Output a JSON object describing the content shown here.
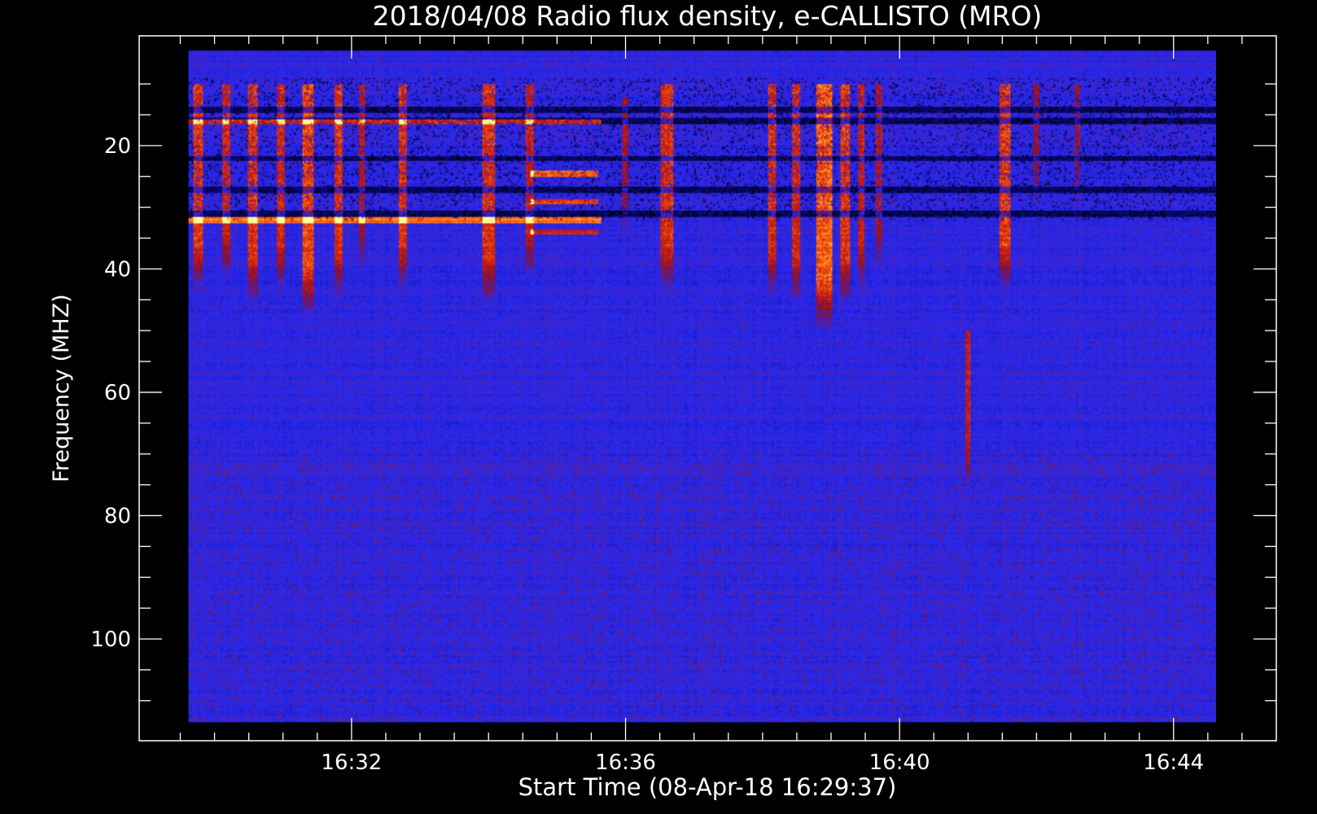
{
  "chart_data": {
    "type": "heatmap",
    "title": "2018/04/08  Radio flux density, e-CALLISTO (MRO)",
    "xlabel": "Start Time (08-Apr-18 16:29:37)",
    "ylabel": "Frequency (MHZ)",
    "x_ticks": [
      "16:32",
      "16:36",
      "16:40",
      "16:44"
    ],
    "x_tick_minutes": [
      32,
      36,
      40,
      44
    ],
    "xlim_minutes": [
      28.9,
      45.5
    ],
    "data_x_range_minutes": [
      29.62,
      44.62
    ],
    "y_ticks": [
      20,
      40,
      60,
      80,
      100
    ],
    "ylim": [
      2.2,
      116.5
    ],
    "data_y_range": [
      4.6,
      113.5
    ],
    "y_inverted": true,
    "colormap": [
      "#000000",
      "#0b0b9a",
      "#2a2af2",
      "#8a1030",
      "#d02010",
      "#ff7010",
      "#ffff90"
    ],
    "background_color": "#2a2af2",
    "bursts": [
      {
        "time_min": 29.75,
        "width_min": 0.12,
        "fmin": 10,
        "fmax": 44,
        "intensity": 0.8
      },
      {
        "time_min": 30.15,
        "width_min": 0.12,
        "fmin": 10,
        "fmax": 42,
        "intensity": 0.75
      },
      {
        "time_min": 30.55,
        "width_min": 0.14,
        "fmin": 10,
        "fmax": 46,
        "intensity": 0.8
      },
      {
        "time_min": 30.95,
        "width_min": 0.12,
        "fmin": 10,
        "fmax": 44,
        "intensity": 0.75
      },
      {
        "time_min": 31.35,
        "width_min": 0.16,
        "fmin": 10,
        "fmax": 48,
        "intensity": 0.9
      },
      {
        "time_min": 31.8,
        "width_min": 0.12,
        "fmin": 10,
        "fmax": 45,
        "intensity": 0.8
      },
      {
        "time_min": 32.15,
        "width_min": 0.1,
        "fmin": 10,
        "fmax": 40,
        "intensity": 0.6
      },
      {
        "time_min": 32.75,
        "width_min": 0.12,
        "fmin": 10,
        "fmax": 44,
        "intensity": 0.8
      },
      {
        "time_min": 34.0,
        "width_min": 0.18,
        "fmin": 10,
        "fmax": 46,
        "intensity": 0.8
      },
      {
        "time_min": 34.6,
        "width_min": 0.12,
        "fmin": 10,
        "fmax": 42,
        "intensity": 0.7
      },
      {
        "time_min": 36.0,
        "width_min": 0.1,
        "fmin": 12,
        "fmax": 35,
        "intensity": 0.55
      },
      {
        "time_min": 36.6,
        "width_min": 0.18,
        "fmin": 10,
        "fmax": 44,
        "intensity": 0.8
      },
      {
        "time_min": 38.15,
        "width_min": 0.12,
        "fmin": 10,
        "fmax": 45,
        "intensity": 0.8
      },
      {
        "time_min": 38.5,
        "width_min": 0.12,
        "fmin": 10,
        "fmax": 46,
        "intensity": 0.8
      },
      {
        "time_min": 38.9,
        "width_min": 0.22,
        "fmin": 10,
        "fmax": 50,
        "intensity": 1.0
      },
      {
        "time_min": 39.2,
        "width_min": 0.14,
        "fmin": 10,
        "fmax": 46,
        "intensity": 0.85
      },
      {
        "time_min": 39.45,
        "width_min": 0.1,
        "fmin": 10,
        "fmax": 44,
        "intensity": 0.7
      },
      {
        "time_min": 39.7,
        "width_min": 0.1,
        "fmin": 10,
        "fmax": 40,
        "intensity": 0.6
      },
      {
        "time_min": 41.0,
        "width_min": 0.06,
        "fmin": 50,
        "fmax": 76,
        "intensity": 0.7
      },
      {
        "time_min": 41.55,
        "width_min": 0.16,
        "fmin": 10,
        "fmax": 44,
        "intensity": 0.85
      },
      {
        "time_min": 42.0,
        "width_min": 0.08,
        "fmin": 10,
        "fmax": 30,
        "intensity": 0.5
      },
      {
        "time_min": 42.6,
        "width_min": 0.08,
        "fmin": 10,
        "fmax": 30,
        "intensity": 0.5
      }
    ],
    "bands": [
      {
        "freq": 16,
        "time_from": 29.62,
        "time_to": 35.65,
        "intensity": 1.0
      },
      {
        "freq": 32,
        "time_from": 29.62,
        "time_to": 35.65,
        "intensity": 0.75
      },
      {
        "freq": 24.5,
        "time_from": 34.6,
        "time_to": 35.6,
        "intensity": 0.7
      },
      {
        "freq": 29,
        "time_from": 34.6,
        "time_to": 35.6,
        "intensity": 0.6
      },
      {
        "freq": 34,
        "time_from": 34.6,
        "time_to": 35.6,
        "intensity": 0.5
      }
    ],
    "dark_bands": [
      14,
      16,
      22,
      27,
      31
    ]
  }
}
